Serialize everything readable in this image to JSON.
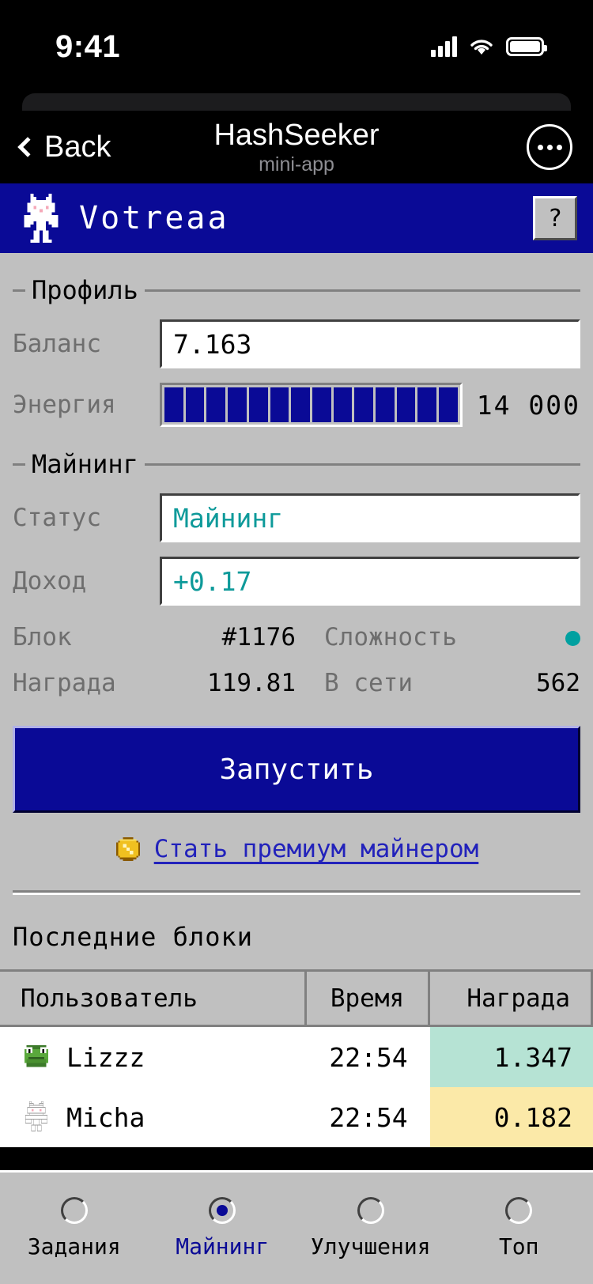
{
  "status_bar": {
    "time": "9:41",
    "signal_icon": "signal-bars-icon",
    "wifi_icon": "wifi-icon",
    "battery_icon": "battery-icon"
  },
  "telegram_nav": {
    "back_label": "Back",
    "back_icon": "chevron-left-icon",
    "title": "HashSeeker",
    "subtitle": "mini-app",
    "more_icon": "more-dots-icon"
  },
  "app_titlebar": {
    "avatar_icon": "pixel-cat-icon",
    "username": "Votreaa",
    "help_label": "?",
    "accent_blue": "#0a0a96"
  },
  "profile": {
    "legend": "Профиль",
    "balance_label": "Баланс",
    "balance_value": "7.163",
    "energy_label": "Энергия",
    "energy_value": "14 000",
    "energy_segments_total": 14,
    "energy_segments_filled": 14
  },
  "mining": {
    "legend": "Майнинг",
    "status_label": "Статус",
    "status_value": "Майнинг",
    "income_label": "Доход",
    "income_value": "+0.17",
    "block_label": "Блок",
    "block_value": "#1176",
    "difficulty_label": "Сложность",
    "difficulty_indicator": "teal-status-dot",
    "reward_label": "Награда",
    "reward_value": "119.81",
    "online_label": "В сети",
    "online_value": "562",
    "start_button": "Запустить",
    "teal_color": "#00a0a0"
  },
  "premium": {
    "icon": "gold-coin-icon",
    "label": "Стать премиум майнером",
    "link_color": "#2222bb"
  },
  "recent_blocks": {
    "title": "Последние блоки",
    "columns": [
      "Пользователь",
      "Время",
      "Награда"
    ],
    "rows": [
      {
        "avatar_icon": "pepe-frog-avatar",
        "user": "Lizzz",
        "time": "22:54",
        "reward": "1.347",
        "reward_bg": "#b6e3d4"
      },
      {
        "avatar_icon": "white-cat-avatar",
        "user": "Micha",
        "time": "22:54",
        "reward": "0.182",
        "reward_bg": "#fbe9a8"
      }
    ]
  },
  "bottom_nav": {
    "items": [
      {
        "label": "Задания",
        "active": false
      },
      {
        "label": "Майнинг",
        "active": true
      },
      {
        "label": "Улучшения",
        "active": false
      },
      {
        "label": "Топ",
        "active": false
      }
    ]
  }
}
